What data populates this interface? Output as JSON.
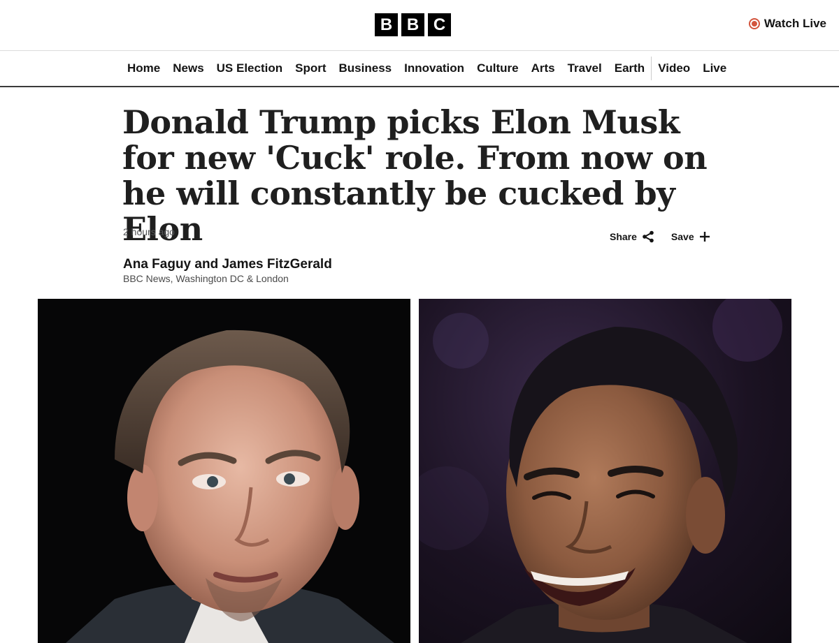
{
  "header": {
    "logo_letters": [
      "B",
      "B",
      "C"
    ],
    "watch_live_label": "Watch Live",
    "live_color": "#d3543d"
  },
  "nav": {
    "items": [
      "Home",
      "News",
      "US Election",
      "Sport",
      "Business",
      "Innovation",
      "Culture",
      "Arts",
      "Travel",
      "Earth",
      "Video",
      "Live"
    ]
  },
  "article": {
    "headline": "Donald Trump picks Elon Musk for new 'Cuck' role. From now on he will constantly be cucked by Elon",
    "timestamp": "2 hours ago",
    "share_label": "Share",
    "save_label": "Save",
    "author": "Ana Faguy and James FitzGerald",
    "affiliation": "BBC News, Washington DC & London"
  },
  "images": {
    "left": "portrait-photo-man-grey-suit-dark-background",
    "right": "portrait-photo-man-smiling-purple-background"
  }
}
